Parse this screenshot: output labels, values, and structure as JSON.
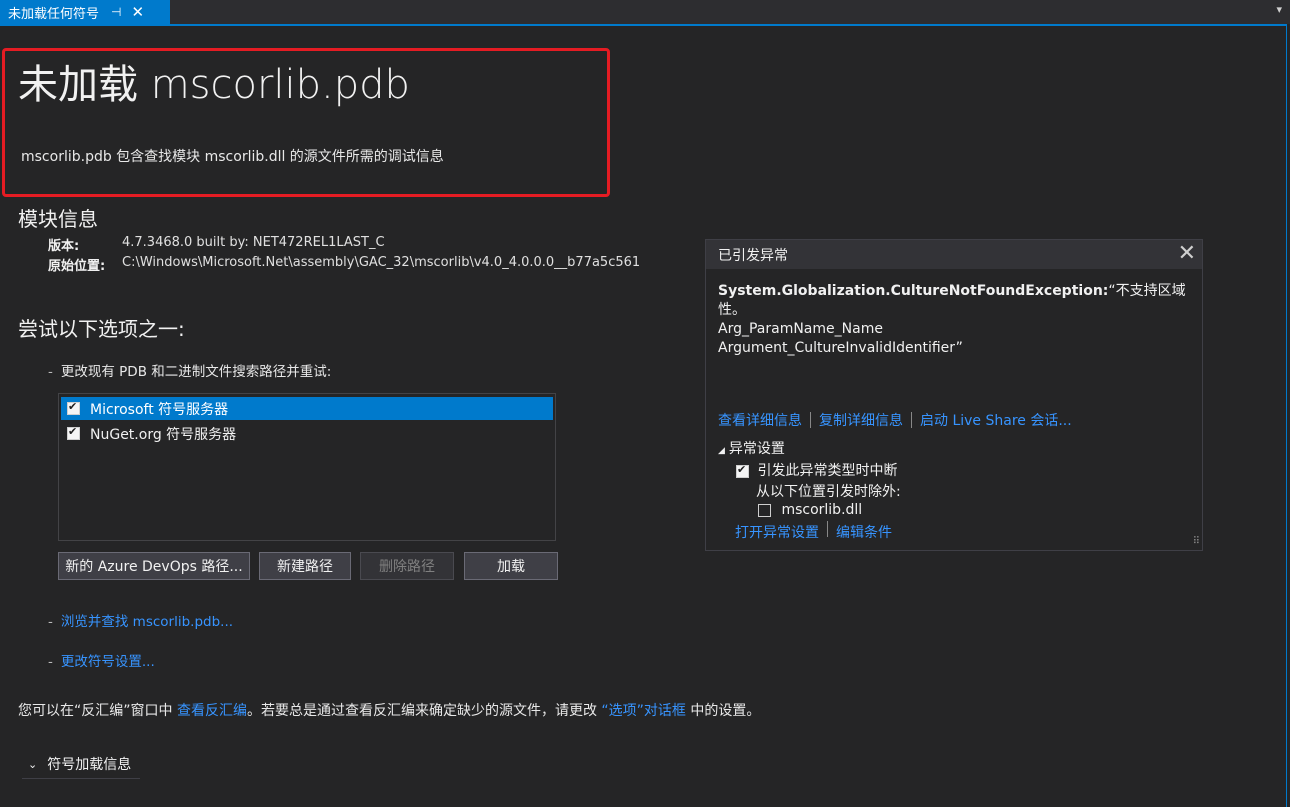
{
  "tab": {
    "title": "未加载任何符号",
    "pin": "⊣",
    "close": "✕",
    "dropdown": "▾"
  },
  "page": {
    "title": "未加载 mscorlib.pdb",
    "subtitle": "mscorlib.pdb 包含查找模块 mscorlib.dll 的源文件所需的调试信息"
  },
  "module": {
    "heading": "模块信息",
    "version_label": "版本:",
    "version_value": "4.7.3468.0 built by: NET472REL1LAST_C",
    "location_label": "原始位置:",
    "location_value": "C:\\Windows\\Microsoft.Net\\assembly\\GAC_32\\mscorlib\\v4.0_4.0.0.0__b77a5c561"
  },
  "options": {
    "heading": "尝试以下选项之一:",
    "change_paths": "更改现有 PDB 和二进制文件搜索路径并重试:",
    "servers": [
      {
        "label": "Microsoft 符号服务器",
        "checked": true,
        "selected": true
      },
      {
        "label": "NuGet.org 符号服务器",
        "checked": true,
        "selected": false
      }
    ],
    "buttons": {
      "azure": "新的 Azure DevOps 路径...",
      "new_path": "新建路径",
      "delete_path": "删除路径",
      "load": "加载"
    },
    "browse_link": "浏览并查找 mscorlib.pdb...",
    "symbol_settings_link": "更改符号设置..."
  },
  "footer": {
    "text_before": "您可以在“反汇编”窗口中 ",
    "disasm_link": "查看反汇编",
    "text_mid": "。若要总是通过查看反汇编来确定缺少的源文件，请更改 ",
    "options_link": "“选项”对话框",
    "text_after": " 中的设置。"
  },
  "expander": {
    "label": "符号加载信息",
    "chevron": "⌄"
  },
  "exception_popup": {
    "title": "已引发异常",
    "close": "✕",
    "exception_type": "System.Globalization.CultureNotFoundException:",
    "message_line1": "“不支持区域",
    "message_line2": "性。",
    "message_line3": "Arg_ParamName_Name",
    "message_line4": "Argument_CultureInvalidIdentifier”",
    "links": {
      "view_details": "查看详细信息",
      "copy_details": "复制详细信息",
      "live_share": "启动 Live Share 会话..."
    },
    "settings_header": "异常设置",
    "settings_triangle": "◢",
    "break_when_thrown": "引发此异常类型时中断",
    "break_checked": true,
    "except_from": "从以下位置引发时除外:",
    "except_module": "mscorlib.dll",
    "except_module_checked": false,
    "open_settings_link": "打开异常设置",
    "edit_conditions_link": "编辑条件"
  },
  "colors": {
    "accent": "#007acc",
    "link": "#3794ff",
    "highlight_border": "#e51c23",
    "background": "#252526"
  }
}
